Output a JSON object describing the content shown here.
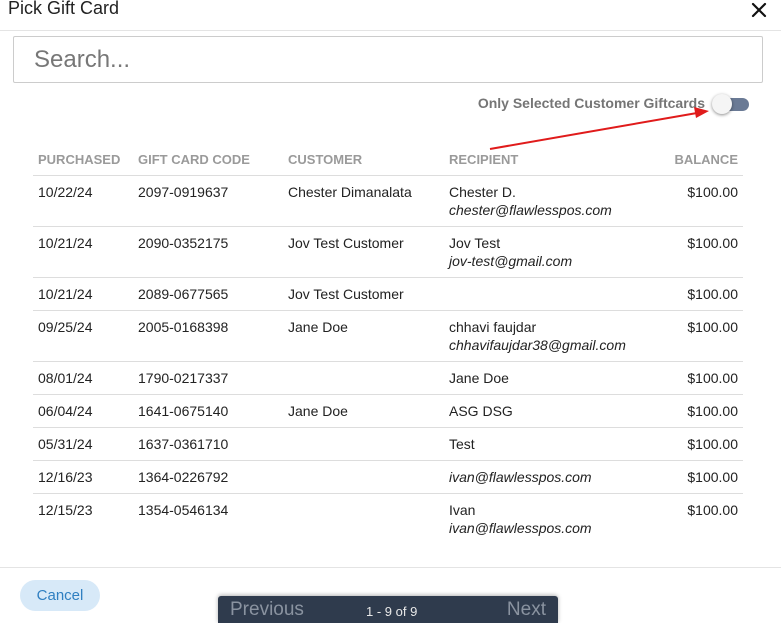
{
  "title": "Pick Gift Card",
  "search": {
    "placeholder": "Search...",
    "value": ""
  },
  "toggle": {
    "label": "Only Selected Customer Giftcards",
    "on": false
  },
  "table": {
    "headers": {
      "purchased": "PURCHASED",
      "code": "GIFT CARD CODE",
      "customer": "CUSTOMER",
      "recipient": "RECIPIENT",
      "balance": "BALANCE"
    },
    "rows": [
      {
        "purchased": "10/22/24",
        "code": "2097-0919637",
        "customer": "Chester Dimanalata",
        "recipient_name": "Chester D.",
        "recipient_email": "chester@flawlesspos.com",
        "balance": "$100.00"
      },
      {
        "purchased": "10/21/24",
        "code": "2090-0352175",
        "customer": "Jov Test Customer",
        "recipient_name": "Jov Test",
        "recipient_email": "jov-test@gmail.com",
        "balance": "$100.00"
      },
      {
        "purchased": "10/21/24",
        "code": "2089-0677565",
        "customer": "Jov Test Customer",
        "recipient_name": "",
        "recipient_email": "",
        "balance": "$100.00"
      },
      {
        "purchased": "09/25/24",
        "code": "2005-0168398",
        "customer": "Jane Doe",
        "recipient_name": "chhavi faujdar",
        "recipient_email": "chhavifaujdar38@gmail.com",
        "balance": "$100.00"
      },
      {
        "purchased": "08/01/24",
        "code": "1790-0217337",
        "customer": "",
        "recipient_name": "Jane Doe",
        "recipient_email": "",
        "balance": "$100.00"
      },
      {
        "purchased": "06/04/24",
        "code": "1641-0675140",
        "customer": "Jane Doe",
        "recipient_name": "ASG DSG",
        "recipient_email": "",
        "balance": "$100.00"
      },
      {
        "purchased": "05/31/24",
        "code": "1637-0361710",
        "customer": "",
        "recipient_name": "Test",
        "recipient_email": "",
        "balance": "$100.00"
      },
      {
        "purchased": "12/16/23",
        "code": "1364-0226792",
        "customer": "",
        "recipient_name": "",
        "recipient_email": "ivan@flawlesspos.com",
        "balance": "$100.00"
      },
      {
        "purchased": "12/15/23",
        "code": "1354-0546134",
        "customer": "",
        "recipient_name": "Ivan",
        "recipient_email": "ivan@flawlesspos.com",
        "balance": "$100.00"
      }
    ]
  },
  "footer": {
    "cancel_label": "Cancel"
  },
  "pager": {
    "previous_label": "Previous",
    "info": "1 - 9 of 9",
    "next_label": "Next"
  },
  "colors": {
    "arrow": "#e01b1b",
    "toggle_track": "#6a7a95",
    "cancel_bg": "#d7e9f8",
    "cancel_text": "#2f7fc1",
    "pager_bg": "#2f3b4d"
  },
  "icons": {
    "close": "close-icon"
  }
}
